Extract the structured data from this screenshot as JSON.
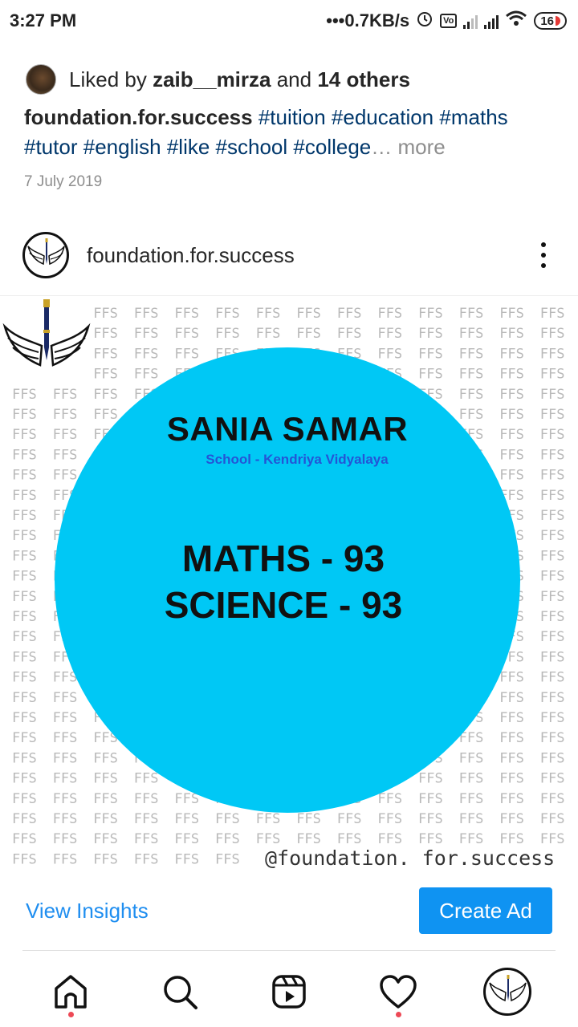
{
  "status_bar": {
    "time": "3:27 PM",
    "net_speed": "•••0.7KB/s",
    "battery": "16"
  },
  "previous_post": {
    "liked_prefix": "Liked by ",
    "liked_user": "zaib__mirza",
    "liked_mid": " and ",
    "liked_others": "14 others",
    "caption_user": "foundation.for.success",
    "caption_tags": [
      "#tuition",
      "#education",
      "#maths",
      "#tutor",
      "#english",
      "#like",
      "#school",
      "#college"
    ],
    "caption_ellipsis": "…",
    "more": " more",
    "date": "7 July 2019"
  },
  "post": {
    "username": "foundation.for.success",
    "image": {
      "pattern_text": "FFS",
      "student_name": "SANIA SAMAR",
      "school": "School - Kendriya Vidyalaya",
      "scores": [
        "MATHS - 93",
        "SCIENCE - 93"
      ],
      "handle": "@foundation. for.success",
      "circle_color": "#00c8f5"
    }
  },
  "actions": {
    "view_insights": "View Insights",
    "create_ad": "Create Ad"
  },
  "bottom_nav": {
    "items": [
      "home-icon",
      "search-icon",
      "reels-icon",
      "heart-icon",
      "profile-avatar"
    ]
  },
  "colors": {
    "link_blue": "#1f8ef0",
    "button_blue": "#0f93f2",
    "hashtag_blue": "#00376b",
    "notification_dot": "#ed4956"
  }
}
